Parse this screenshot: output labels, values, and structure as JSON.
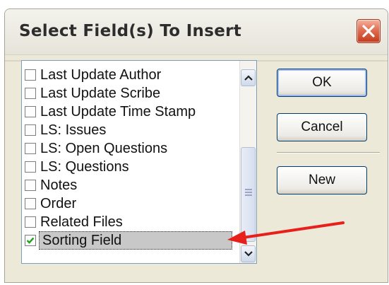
{
  "dialog": {
    "title": "Select Field(s) To Insert"
  },
  "fields": [
    {
      "label": "Last Update Author",
      "checked": false
    },
    {
      "label": "Last Update Scribe",
      "checked": false
    },
    {
      "label": "Last Update Time Stamp",
      "checked": false
    },
    {
      "label": "LS: Issues",
      "checked": false
    },
    {
      "label": "LS: Open Questions",
      "checked": false
    },
    {
      "label": "LS: Questions",
      "checked": false
    },
    {
      "label": "Notes",
      "checked": false
    },
    {
      "label": "Order",
      "checked": false
    },
    {
      "label": "Related Files",
      "checked": false
    },
    {
      "label": "Sorting Field",
      "checked": true,
      "selected": true
    }
  ],
  "buttons": {
    "ok": "OK",
    "cancel": "Cancel",
    "new": "New"
  },
  "colors": {
    "dialog_bg": "#ece9d8",
    "close_button": "#e06e52",
    "annotation_arrow": "#e8201c",
    "checkmark": "#21a121"
  }
}
